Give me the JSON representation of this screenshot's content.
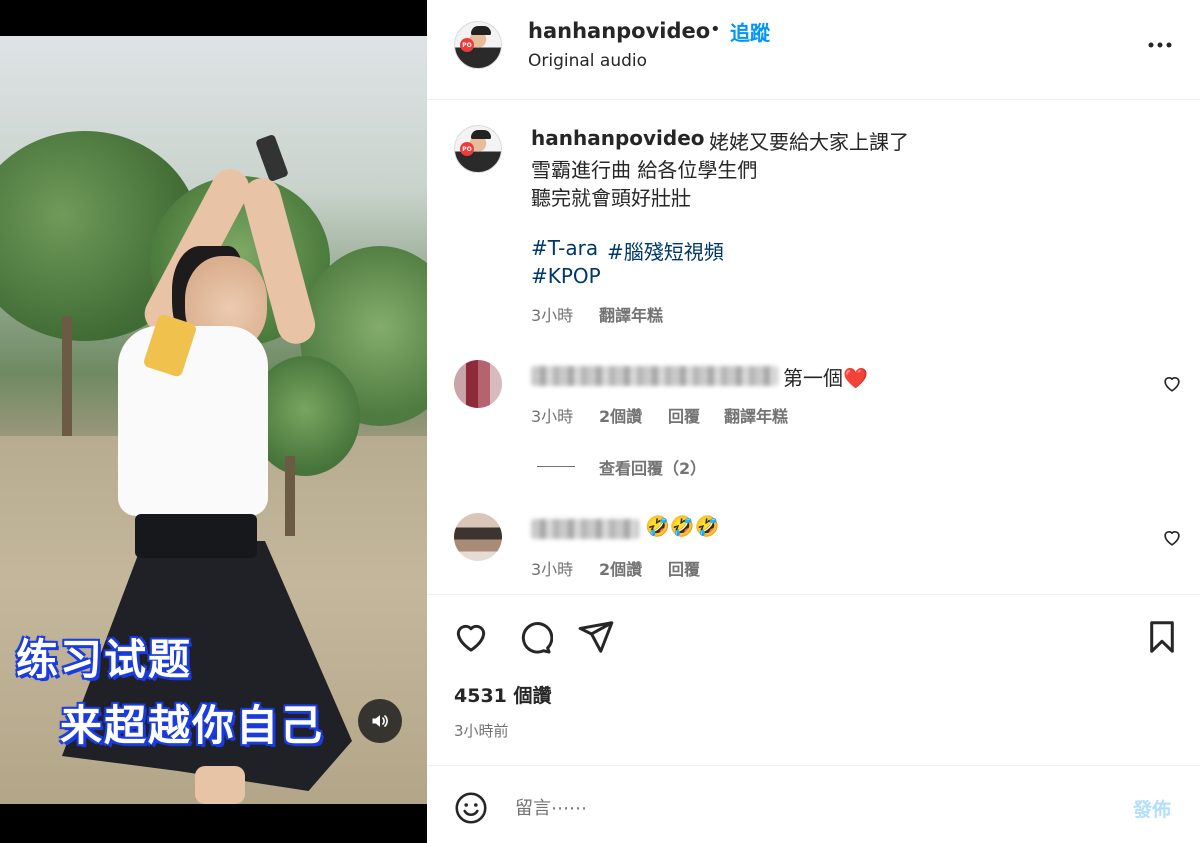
{
  "video": {
    "subtitle_line1": "练习试题",
    "subtitle_line2": "来超越你自己"
  },
  "header": {
    "username": "hanhanpovideo",
    "separator": "•",
    "follow_label": "追蹤",
    "audio_label": "Original audio",
    "avatar_badge": "PO"
  },
  "caption": {
    "username": "hanhanpovideo",
    "first_line": "姥姥又要給大家上課了",
    "lines": [
      "雪霸進行曲 給各位學生們",
      "聽完就會頭好壯壯"
    ],
    "hashtags": [
      "#T-ara",
      "#腦殘短視頻",
      "#KPOP"
    ],
    "time": "3小時",
    "translate_label": "翻譯年糕"
  },
  "comments": [
    {
      "text": "第一個",
      "emoji": "❤️",
      "time": "3小時",
      "likes": "2個讚",
      "reply_label": "回覆",
      "translate_label": "翻譯年糕",
      "view_replies_label": "查看回覆（2）"
    },
    {
      "text": "🤣🤣🤣",
      "time": "3小時",
      "likes": "2個讚",
      "reply_label": "回覆"
    }
  ],
  "actions": {
    "likes_count": "4531 個讚",
    "posted_time": "3小時前"
  },
  "composer": {
    "placeholder": "留言⋯⋯",
    "post_label": "發佈"
  },
  "colors": {
    "link_blue": "#0095f6",
    "hashtag_navy": "#00376b",
    "muted_gray": "#737373",
    "subtitle_outline": "#1b3ce0",
    "post_disabled": "#b2dffc"
  }
}
